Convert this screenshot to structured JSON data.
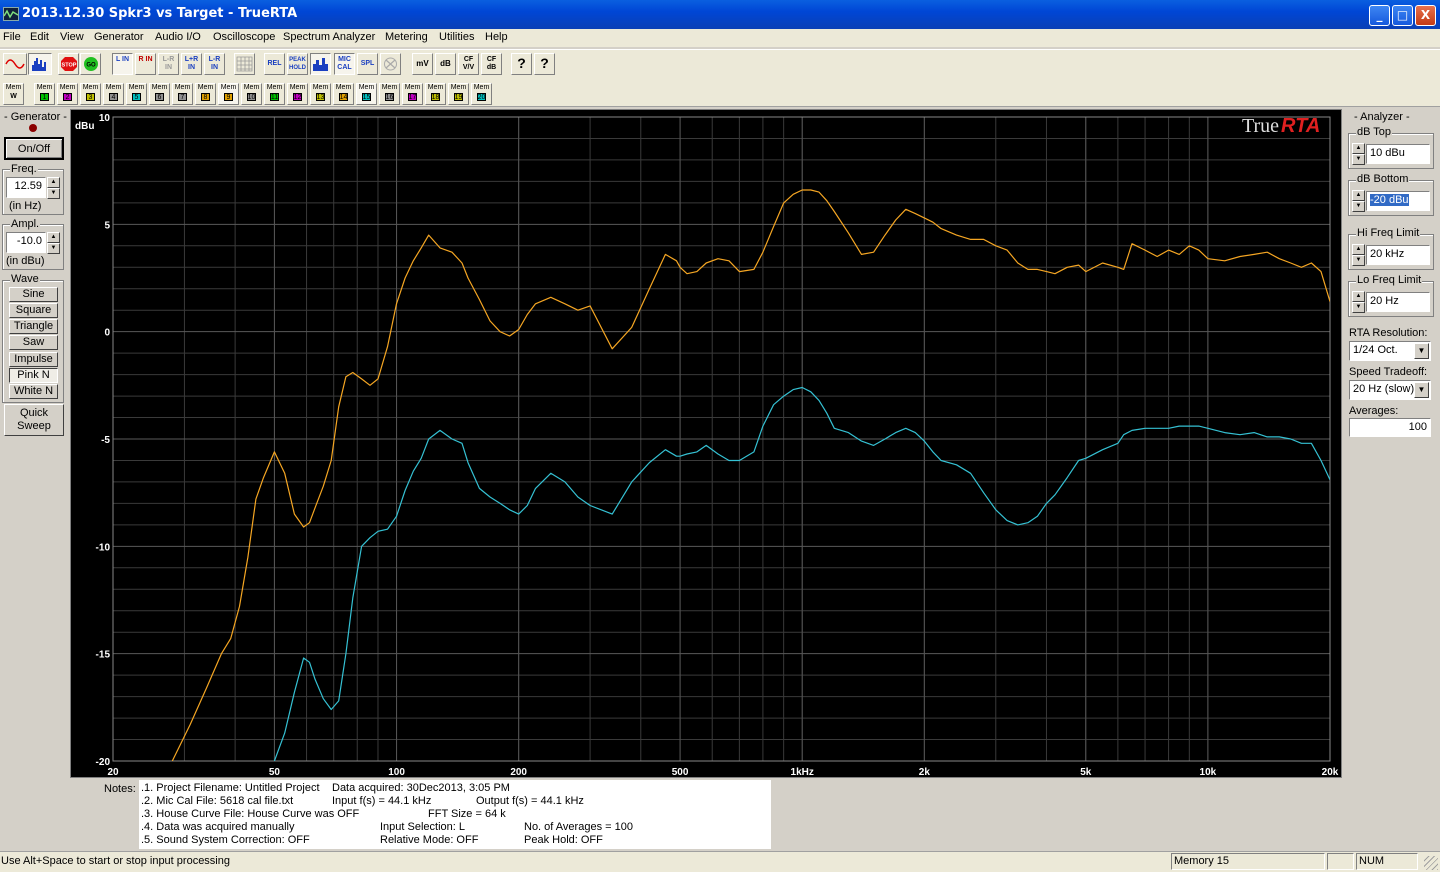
{
  "window": {
    "title": "2013.12.30 Spkr3 vs Target - TrueRTA",
    "minimize_glyph": "_",
    "maximize_glyph": "□",
    "close_glyph": "X"
  },
  "menu": [
    "File",
    "Edit",
    "View",
    "Generator",
    "Audio I/O",
    "Oscilloscope",
    "Spectrum Analyzer",
    "Metering",
    "Utilities",
    "Help"
  ],
  "toolbar": {
    "buttons": [
      {
        "name": "sine-wave-view-button",
        "label": "",
        "icon": "sine-wave-icon"
      },
      {
        "name": "spectrum-view-button",
        "label": "",
        "icon": "spectrum-bars-icon",
        "pressed": true
      },
      {
        "name": "stop-button",
        "label": "STOP",
        "icon": "stop-icon"
      },
      {
        "name": "go-button",
        "label": "GO",
        "icon": "go-icon"
      },
      {
        "name": "left-input-button",
        "label": "L IN",
        "pressed": true
      },
      {
        "name": "right-input-button",
        "label": "R IN"
      },
      {
        "name": "l-minus-r-input-button",
        "label": "L-R IN"
      },
      {
        "name": "l-plus-r-input-button",
        "label": "L+R IN"
      },
      {
        "name": "l-r-diff-input-button",
        "label": "L-R IN"
      },
      {
        "name": "grid-button",
        "label": "",
        "icon": "grid-icon"
      },
      {
        "name": "relative-button",
        "label": "REL"
      },
      {
        "name": "peak-hold-button",
        "label": "PEAK HOLD"
      },
      {
        "name": "bar-graph-button",
        "label": "",
        "icon": "bar-graph-icon",
        "pressed": true
      },
      {
        "name": "mic-cal-button",
        "label": "MIC CAL",
        "pressed": true
      },
      {
        "name": "spl-button",
        "label": "SPL"
      },
      {
        "name": "disabled-button",
        "label": "",
        "icon": "x-icon"
      },
      {
        "name": "mv-button",
        "label": "mV"
      },
      {
        "name": "db-button",
        "label": "dB"
      },
      {
        "name": "cf-vv-button",
        "label": "CF V/V"
      },
      {
        "name": "cf-db-button",
        "label": "CF dB"
      },
      {
        "name": "help-button",
        "label": "?",
        "icon": "help-icon"
      },
      {
        "name": "context-help-button",
        "label": "?",
        "icon": "context-help-icon"
      }
    ],
    "memories": [
      {
        "label": "Mem",
        "num": "W"
      },
      {
        "label": "Mem",
        "num": "1",
        "color": "#00c000"
      },
      {
        "label": "Mem",
        "num": "2",
        "color": "#c000c0"
      },
      {
        "label": "Mem",
        "num": "3",
        "color": "#c0c000"
      },
      {
        "label": "Mem",
        "num": "4",
        "color": "#909090"
      },
      {
        "label": "Mem",
        "num": "5",
        "color": "#00c0c0"
      },
      {
        "label": "Mem",
        "num": "6",
        "color": "#909090"
      },
      {
        "label": "Mem",
        "num": "7",
        "color": "#909090"
      },
      {
        "label": "Mem",
        "num": "8",
        "color": "#e0a000"
      },
      {
        "label": "Mem",
        "num": "9",
        "color": "#e0a000",
        "pressed": true
      },
      {
        "label": "Mem",
        "num": "10",
        "color": "#909090"
      },
      {
        "label": "Mem",
        "num": "11",
        "color": "#00c000"
      },
      {
        "label": "Mem",
        "num": "12",
        "color": "#c000c0"
      },
      {
        "label": "Mem",
        "num": "13",
        "color": "#c0c000"
      },
      {
        "label": "Mem",
        "num": "14",
        "color": "#e0a000"
      },
      {
        "label": "Mem",
        "num": "15",
        "color": "#00c0c0",
        "pressed": true
      },
      {
        "label": "Mem",
        "num": "16",
        "color": "#909090"
      },
      {
        "label": "Mem",
        "num": "17",
        "color": "#c000c0"
      },
      {
        "label": "Mem",
        "num": "18",
        "color": "#c0c000"
      },
      {
        "label": "Mem",
        "num": "19",
        "color": "#c0c000"
      },
      {
        "label": "Mem",
        "num": "20",
        "color": "#00c0c0"
      }
    ]
  },
  "generator": {
    "title": "- Generator -",
    "on_off": "On/Off",
    "freq_label": "Freq.",
    "freq_value": "12.59",
    "freq_unit": "(in Hz)",
    "ampl_label": "Ampl.",
    "ampl_value": "-10.0",
    "ampl_unit": "(in dBu)",
    "wave_label": "Wave",
    "waves": [
      "Sine",
      "Square",
      "Triangle",
      "Saw",
      "Impulse",
      "Pink N",
      "White N"
    ],
    "selected_wave": "Pink N",
    "quick_sweep_line1": "Quick",
    "quick_sweep_line2": "Sweep"
  },
  "analyzer": {
    "title": "- Analyzer -",
    "db_top_label": "dB Top",
    "db_top_value": "10 dBu",
    "db_bottom_label": "dB Bottom",
    "db_bottom_value": "-20 dBu",
    "hi_freq_label": "Hi Freq Limit",
    "hi_freq_value": "20 kHz",
    "lo_freq_label": "Lo Freq Limit",
    "lo_freq_value": "20 Hz",
    "resolution_label": "RTA Resolution:",
    "resolution_value": "1/24 Oct.",
    "speed_label": "Speed Tradeoff:",
    "speed_value": "20 Hz (slow)",
    "averages_label": "Averages:",
    "averages_value": "100"
  },
  "chart_data": {
    "type": "line",
    "brand_text_1": "True",
    "brand_text_2": "RTA",
    "ylabel": "dBu",
    "x_scale": "log",
    "xlim": [
      20,
      20000
    ],
    "ylim": [
      -20,
      10
    ],
    "y_ticks": [
      10,
      5,
      0,
      -5,
      -10,
      -15,
      -20
    ],
    "y_tick_labels": [
      "10",
      "5",
      "0",
      "-5",
      "-10",
      "-15",
      "-20"
    ],
    "x_ticks": [
      20,
      50,
      100,
      200,
      500,
      1000,
      2000,
      5000,
      10000,
      20000
    ],
    "x_tick_labels": [
      "20",
      "50",
      "100",
      "200",
      "500",
      "1kHz",
      "2k",
      "5k",
      "10k",
      "20k"
    ],
    "grid": true,
    "background": "#000000",
    "grid_color": "#3a3a3a",
    "series": [
      {
        "color": "#f5a623",
        "x": [
          28,
          31,
          34,
          37,
          39,
          41,
          43,
          45,
          47,
          50,
          53,
          56,
          59,
          61,
          63,
          66,
          69,
          72,
          75,
          78,
          82,
          86,
          90,
          95,
          100,
          105,
          110,
          115,
          120,
          128,
          137,
          145,
          150,
          160,
          170,
          180,
          190,
          200,
          210,
          220,
          240,
          260,
          280,
          300,
          340,
          380,
          420,
          460,
          490,
          500,
          520,
          550,
          580,
          620,
          660,
          700,
          760,
          800,
          850,
          900,
          950,
          1000,
          1050,
          1100,
          1150,
          1200,
          1300,
          1400,
          1500,
          1600,
          1700,
          1800,
          1900,
          2000,
          2100,
          2200,
          2400,
          2600,
          2800,
          3000,
          3200,
          3400,
          3600,
          3800,
          4000,
          4200,
          4500,
          4800,
          5000,
          5500,
          6000,
          6200,
          6500,
          7000,
          7500,
          8000,
          8500,
          9000,
          9500,
          10000,
          11000,
          12000,
          13000,
          14000,
          15000,
          16000,
          17000,
          18000,
          19000,
          20000
        ],
        "y": [
          -20,
          -18.3,
          -16.6,
          -15,
          -14.3,
          -12.8,
          -10.5,
          -7.8,
          -6.8,
          -5.6,
          -6.6,
          -8.5,
          -9.1,
          -8.9,
          -8.2,
          -7.2,
          -6.0,
          -3.5,
          -2.1,
          -1.9,
          -2.2,
          -2.5,
          -2.2,
          -0.7,
          1.3,
          2.5,
          3.3,
          3.9,
          4.5,
          3.9,
          3.7,
          3.2,
          2.5,
          1.5,
          0.5,
          0.0,
          -0.2,
          0.1,
          0.8,
          1.3,
          1.6,
          1.3,
          1.0,
          1.2,
          -0.8,
          0.2,
          2.0,
          3.6,
          3.3,
          3.0,
          2.7,
          2.8,
          3.2,
          3.4,
          3.3,
          2.8,
          2.9,
          3.7,
          4.9,
          6.0,
          6.4,
          6.6,
          6.6,
          6.5,
          6.1,
          5.6,
          4.6,
          3.6,
          3.7,
          4.5,
          5.2,
          5.7,
          5.5,
          5.3,
          5.1,
          4.8,
          4.5,
          4.3,
          4.3,
          4.0,
          3.8,
          3.2,
          2.9,
          2.9,
          2.8,
          2.7,
          3.0,
          3.1,
          2.8,
          3.2,
          3.0,
          2.9,
          4.1,
          3.8,
          3.5,
          3.8,
          3.6,
          4.0,
          3.8,
          3.4,
          3.3,
          3.5,
          3.6,
          3.7,
          3.4,
          3.2,
          3.0,
          3.2,
          2.8,
          1.4
        ]
      },
      {
        "color": "#35c1d3",
        "x": [
          50,
          53,
          56,
          59,
          61,
          63,
          66,
          69,
          72,
          75,
          78,
          82,
          86,
          90,
          95,
          100,
          105,
          110,
          115,
          120,
          128,
          137,
          145,
          150,
          160,
          170,
          180,
          190,
          200,
          210,
          220,
          240,
          260,
          280,
          300,
          340,
          380,
          420,
          460,
          490,
          500,
          520,
          550,
          580,
          620,
          660,
          700,
          760,
          800,
          850,
          900,
          950,
          1000,
          1050,
          1100,
          1150,
          1200,
          1300,
          1400,
          1500,
          1600,
          1700,
          1800,
          1900,
          2000,
          2100,
          2200,
          2400,
          2600,
          2800,
          3000,
          3200,
          3400,
          3600,
          3800,
          4000,
          4200,
          4500,
          4800,
          5000,
          5500,
          6000,
          6200,
          6500,
          7000,
          7500,
          8000,
          8500,
          9000,
          9500,
          10000,
          11000,
          12000,
          13000,
          14000,
          15000,
          16000,
          17000,
          18000,
          19000,
          20000
        ],
        "y": [
          -20,
          -18.7,
          -16.8,
          -15.2,
          -15.4,
          -16.2,
          -17.1,
          -17.6,
          -17.2,
          -15.0,
          -12.4,
          -10.0,
          -9.6,
          -9.3,
          -9.2,
          -8.6,
          -7.4,
          -6.5,
          -5.9,
          -5.0,
          -4.6,
          -5.0,
          -5.2,
          -6.1,
          -7.3,
          -7.7,
          -8.0,
          -8.3,
          -8.5,
          -8.1,
          -7.3,
          -6.6,
          -7.0,
          -7.7,
          -8.1,
          -8.5,
          -7.0,
          -6.1,
          -5.5,
          -5.8,
          -5.8,
          -5.7,
          -5.6,
          -5.3,
          -5.7,
          -6.0,
          -6.0,
          -5.6,
          -4.4,
          -3.4,
          -3.0,
          -2.7,
          -2.6,
          -2.8,
          -3.2,
          -3.8,
          -4.5,
          -4.7,
          -5.1,
          -5.3,
          -5.0,
          -4.7,
          -4.5,
          -4.7,
          -5.1,
          -5.6,
          -6.0,
          -6.2,
          -6.6,
          -7.5,
          -8.3,
          -8.8,
          -9.0,
          -8.9,
          -8.6,
          -8.0,
          -7.6,
          -6.8,
          -6.0,
          -5.9,
          -5.5,
          -5.2,
          -4.8,
          -4.6,
          -4.5,
          -4.5,
          -4.5,
          -4.4,
          -4.4,
          -4.4,
          -4.5,
          -4.7,
          -4.8,
          -4.7,
          -4.9,
          -4.9,
          -5.0,
          -5.2,
          -5.2,
          -6.0,
          -6.9
        ]
      }
    ]
  },
  "notes": {
    "label": "Notes:",
    "lines": [
      {
        "left": ".1. Project Filename: Untitled Project",
        "mid": "Data acquired: 30Dec2013, 3:05 PM",
        "right": ""
      },
      {
        "left": ".2. Mic Cal File: 5618 cal file.txt",
        "mid": "Input f(s) = 44.1 kHz",
        "right": "Output f(s) = 44.1 kHz"
      },
      {
        "left": ".3. House Curve File: House Curve was OFF",
        "mid": "FFT Size = 64 k",
        "right": ""
      },
      {
        "left": ".4. Data was acquired manually",
        "mid": "Input Selection: L",
        "right": "No. of Averages = 100"
      },
      {
        "left": ".5. Sound System Correction: OFF",
        "mid": "Relative Mode:  OFF",
        "right": "Peak Hold: OFF"
      }
    ]
  },
  "status": {
    "hint": "Use Alt+Space to start or stop input processing",
    "memory": "Memory 15",
    "num": "NUM"
  }
}
